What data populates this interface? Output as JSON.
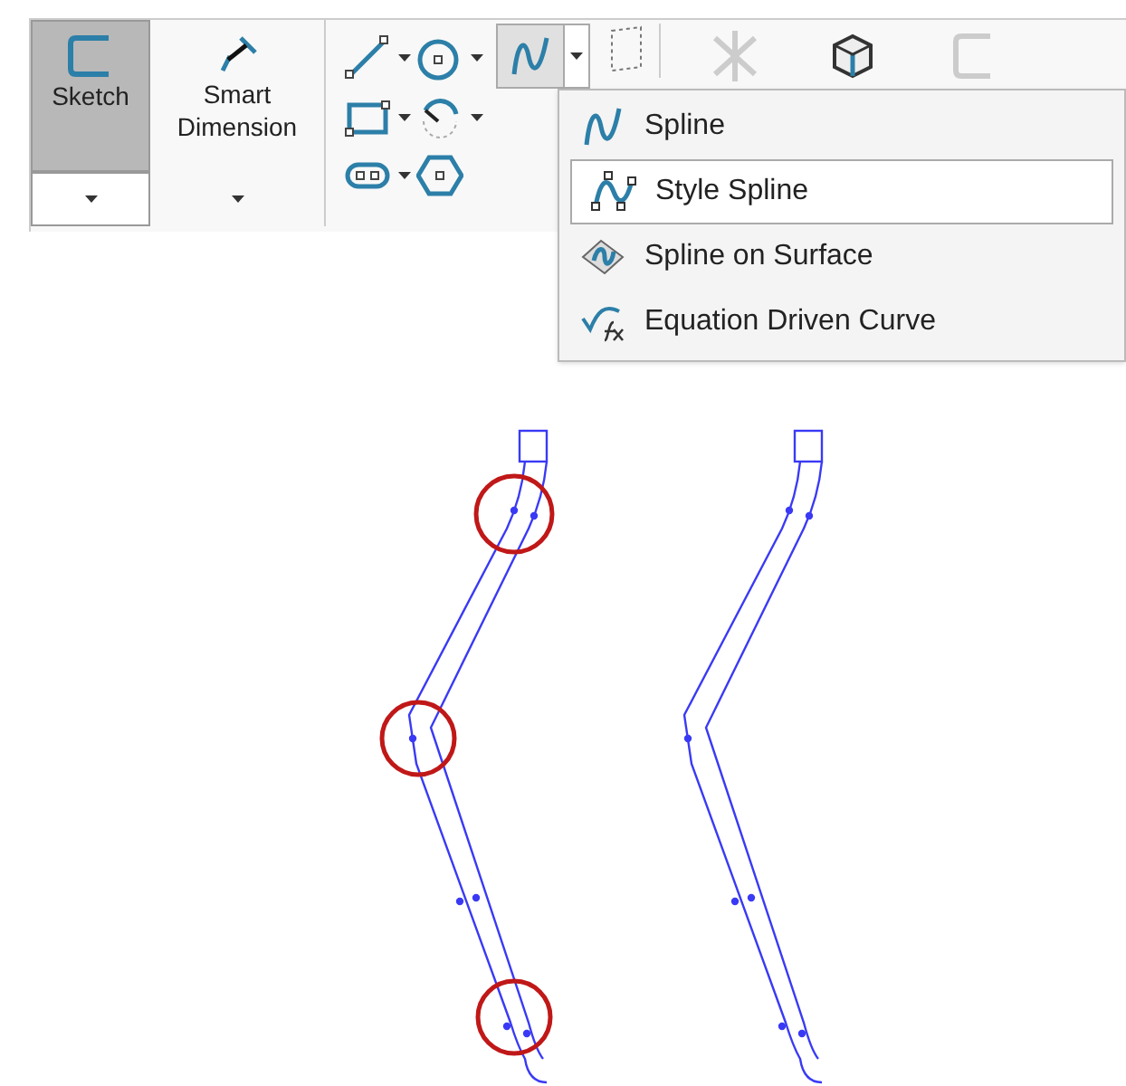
{
  "toolbar": {
    "buttons": [
      {
        "label": "Sketch",
        "pressed": true
      },
      {
        "label": "Smart Dimension",
        "pressed": false
      }
    ]
  },
  "spline_menu": {
    "items": [
      {
        "label": "Spline",
        "selected": false
      },
      {
        "label": "Style Spline",
        "selected": true
      },
      {
        "label": "Spline on Surface",
        "selected": false
      },
      {
        "label": "Equation Driven Curve",
        "selected": false
      }
    ]
  }
}
